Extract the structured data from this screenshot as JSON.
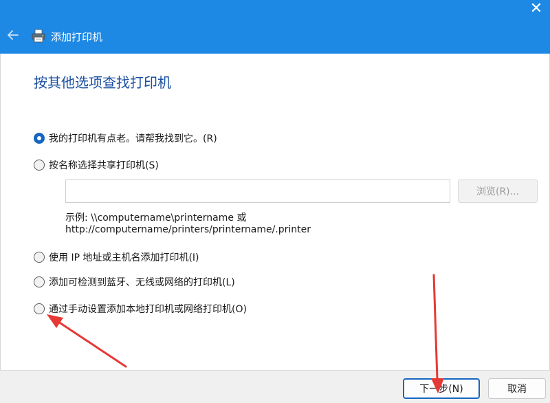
{
  "window": {
    "title": "添加打印机",
    "close_glyph": "✕"
  },
  "main": {
    "heading": "按其他选项查找打印机",
    "options": [
      {
        "label": "我的打印机有点老。请帮我找到它。(R)",
        "checked": true
      },
      {
        "label": "按名称选择共享打印机(S)",
        "checked": false
      },
      {
        "label": "使用 IP 地址或主机名添加打印机(I)",
        "checked": false
      },
      {
        "label": "添加可检测到蓝牙、无线或网络的打印机(L)",
        "checked": false
      },
      {
        "label": "通过手动设置添加本地打印机或网络打印机(O)",
        "checked": false
      }
    ],
    "share_input": {
      "value": "",
      "placeholder": ""
    },
    "browse_label": "浏览(R)...",
    "example_line1": "示例: \\\\computername\\printername 或",
    "example_line2": "http://computername/printers/printername/.printer"
  },
  "footer": {
    "next_label": "下一步(N)",
    "cancel_label": "取消"
  },
  "colors": {
    "titlebar": "#1e88e5",
    "heading": "#1a4fa0",
    "accent": "#1566c0",
    "annotation_arrow": "#e53935"
  },
  "icons": {
    "back": "back-arrow-icon",
    "printer": "printer-icon",
    "close": "close-icon"
  }
}
